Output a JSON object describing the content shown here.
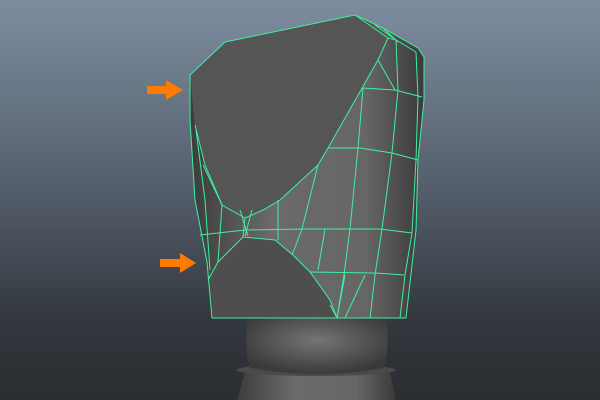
{
  "viewport": {
    "name": "3D viewport"
  },
  "colors": {
    "wireframe": "#3ef0a0",
    "arrow": "#ff7a00",
    "mesh_dark": "#505050",
    "mesh_light": "#6e6e6e"
  },
  "icons": [
    "arrow-right-icon",
    "arrow-right-icon"
  ]
}
